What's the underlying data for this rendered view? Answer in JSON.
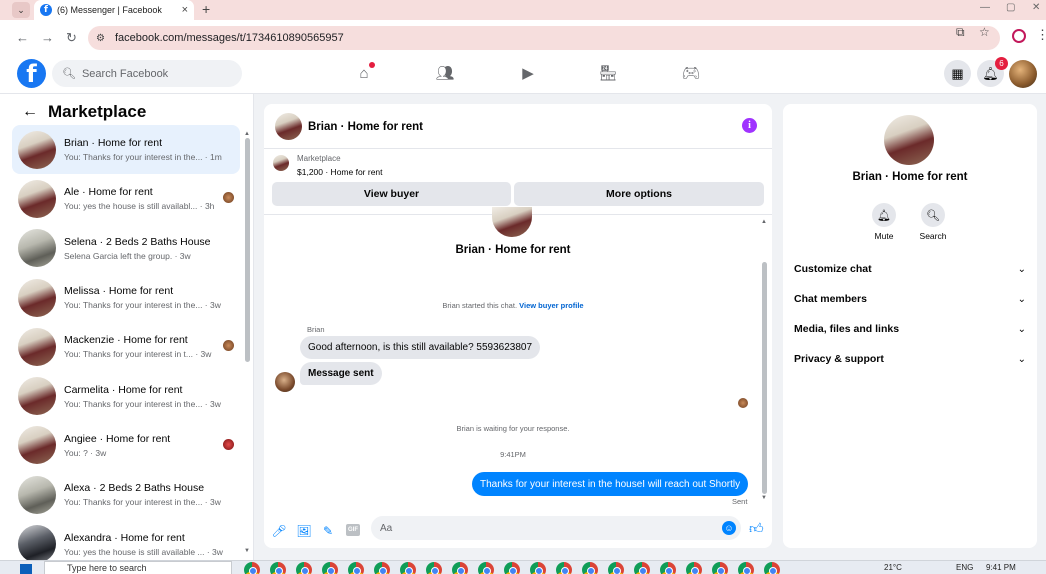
{
  "browser": {
    "tab_title": "(6) Messenger | Facebook",
    "url": "facebook.com/messages/t/1734610890565957"
  },
  "fb": {
    "search_placeholder": "Search Facebook",
    "notification_count": "6"
  },
  "marketplace": {
    "title": "Marketplace",
    "conversations": [
      {
        "name": "Brian · Home for rent",
        "preview": "You: Thanks for your interest in the... · 1m",
        "active": true,
        "avatar": "house",
        "seen": false
      },
      {
        "name": "Ale · Home for rent",
        "preview": "You: yes the house is still availabl... · 3h",
        "active": false,
        "avatar": "house",
        "seen": true
      },
      {
        "name": "Selena · 2 Beds 2 Baths House",
        "preview": "Selena Garcia left the group. · 3w",
        "active": false,
        "avatar": "alt",
        "seen": false
      },
      {
        "name": "Melissa · Home for rent",
        "preview": "You: Thanks for your interest in the... · 3w",
        "active": false,
        "avatar": "house",
        "seen": false
      },
      {
        "name": "Mackenzie · Home for rent",
        "preview": "You: Thanks for your interest in t... · 3w",
        "active": false,
        "avatar": "house",
        "seen": true
      },
      {
        "name": "Carmelita · Home for rent",
        "preview": "You: Thanks for your interest in the... · 3w",
        "active": false,
        "avatar": "house",
        "seen": false
      },
      {
        "name": "Angiee · Home for rent",
        "preview": "You: ? · 3w",
        "active": false,
        "avatar": "house",
        "seen": true
      },
      {
        "name": "Alexa · 2 Beds 2 Baths House",
        "preview": "You: Thanks for your interest in the... · 3w",
        "active": false,
        "avatar": "alt",
        "seen": false
      },
      {
        "name": "Alexandra · Home for rent",
        "preview": "You: yes the house is still available ... · 3w",
        "active": false,
        "avatar": "dark",
        "seen": false
      }
    ]
  },
  "chat": {
    "title": "Brian · Home for rent",
    "listing_label": "Marketplace",
    "listing_price": "$1,200 · Home for rent",
    "view_buyer": "View buyer",
    "more_options": "More options",
    "started_text": "Brian started this chat.",
    "view_buyer_profile": "View buyer profile",
    "sender": "Brian",
    "messages_in": [
      "Good afternoon, is this still available? 5593623807",
      "Message sent"
    ],
    "waiting_text": "Brian is waiting for your response.",
    "timestamp": "9:41PM",
    "message_out": "Thanks for your interest in the houseI will reach out Shortly",
    "sent_label": "Sent",
    "composer_placeholder": "Aa",
    "gif_label": "GIF"
  },
  "details": {
    "name": "Brian · Home for rent",
    "actions": [
      "Mute",
      "Search"
    ],
    "sections": [
      "Customize chat",
      "Chat members",
      "Media, files and links",
      "Privacy & support"
    ]
  },
  "taskbar": {
    "search_placeholder": "Type here to search",
    "temp": "21°C",
    "lang": "ENG",
    "time": "9:41 PM"
  },
  "colors": {
    "fb_blue": "#1877f2",
    "messenger_blue": "#0084ff",
    "active_row": "#e7f1fd",
    "info_purple": "#a033ff"
  }
}
